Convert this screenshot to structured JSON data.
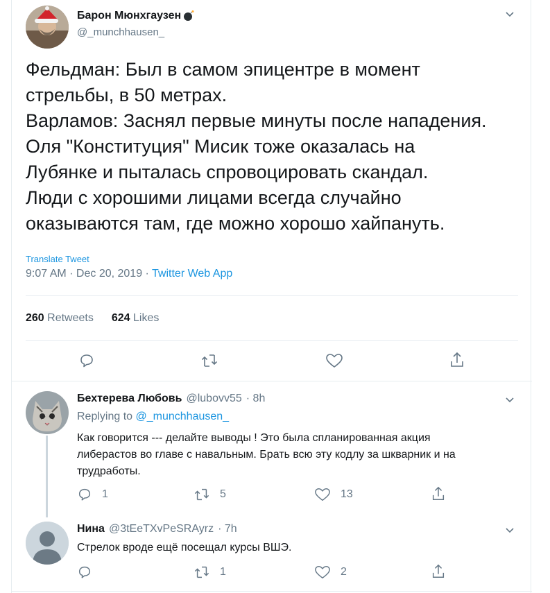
{
  "main_tweet": {
    "author_name": "Барон Мюнхгаузен",
    "author_handle": "@_munchhausen_",
    "text_lines": [
      "Фельдман: Был в самом эпицентре в момент",
      "стрельбы, в 50 метрах.",
      "Варламов: Заснял первые минуты после нападения.",
      "Оля \"Конституция\" Мисик тоже оказалась на",
      "Лубянке и пыталась спровоцировать скандал.",
      "Люди с хорошими лицами всегда случайно",
      "оказываются там, где можно хорошо хайпануть."
    ],
    "translate_label": "Translate Tweet",
    "timestamp": "9:07 AM · Dec 20, 2019 · ",
    "source": "Twitter Web App",
    "retweets_count": "260",
    "retweets_label": "Retweets",
    "likes_count": "624",
    "likes_label": "Likes"
  },
  "replies": [
    {
      "author_name": "Бехтерева Любовь",
      "author_handle": "@lubovv55",
      "time": "· 8h",
      "replying_prefix": "Replying to ",
      "replying_handle": "@_munchhausen_",
      "text_lines": [
        "Как говорится --- делайте выводы ! Это была спланированная акция",
        "либерастов во главе с навальным. Брать всю эту кодлу за шкварник и на",
        "трудработы."
      ],
      "reply_count": "1",
      "retweet_count": "5",
      "like_count": "13"
    },
    {
      "author_name": "Нина",
      "author_handle": "@3tEeTXvPeSRAyrz",
      "time": "· 7h",
      "text_lines": [
        "Стрелок вроде ещё посещал курсы ВШЭ."
      ],
      "reply_count": "",
      "retweet_count": "1",
      "like_count": "2"
    }
  ],
  "colors": {
    "link": "#1b95e0",
    "muted": "#657786",
    "border": "#e6ecf0",
    "text": "#14171a"
  },
  "icons": [
    "reply-icon",
    "retweet-icon",
    "like-icon",
    "share-icon",
    "chevron-down-icon",
    "bomb-icon"
  ]
}
